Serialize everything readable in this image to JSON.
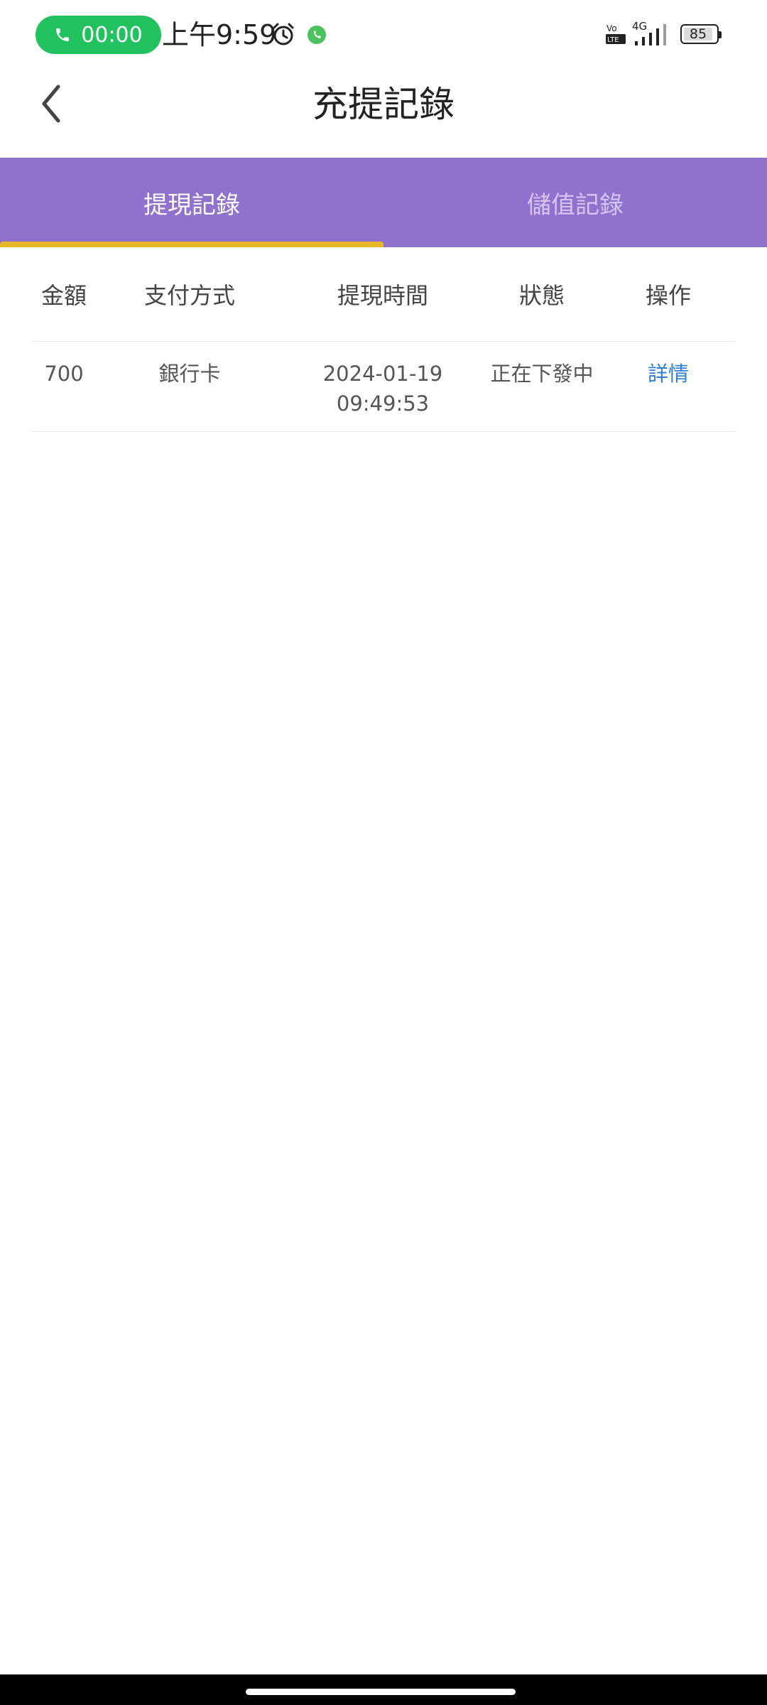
{
  "status_bar": {
    "call_timer": "00:00",
    "time": "上午9:59",
    "battery": "85",
    "network": "4G"
  },
  "header": {
    "title": "充提記錄"
  },
  "tabs": [
    {
      "label": "提現記錄",
      "active": true
    },
    {
      "label": "儲值記錄",
      "active": false
    }
  ],
  "table": {
    "columns": [
      "金額",
      "支付方式",
      "提現時間",
      "狀態",
      "操作"
    ],
    "rows": [
      {
        "amount": "700",
        "method": "銀行卡",
        "date": "2024-01-19",
        "time": "09:49:53",
        "status": "正在下發中",
        "action": "詳情"
      }
    ]
  },
  "colors": {
    "tab_bar": "#9071ce",
    "tab_indicator": "#e6b92b",
    "link": "#2d7fd6",
    "call_pill": "#22c35e"
  }
}
